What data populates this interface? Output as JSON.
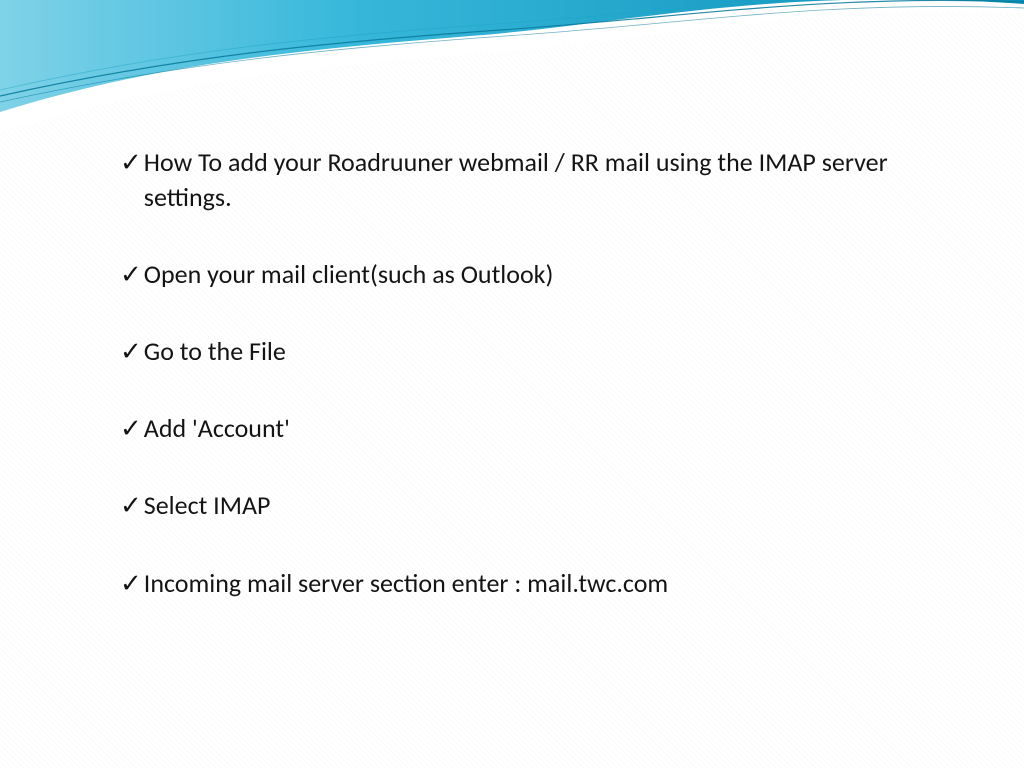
{
  "theme": {
    "swoosh_gradient_start": "#7fd2e8",
    "swoosh_gradient_mid": "#36b7da",
    "swoosh_gradient_end": "#0b8fb8",
    "accent_line": "#0b7c9c",
    "text_color": "#141414",
    "check_glyph": "✓"
  },
  "bullets": [
    "How To add your Roadruuner webmail / RR mail using the IMAP server settings.",
    "Open your mail client(such as Outlook)",
    "Go to the File",
    "Add 'Account'",
    "Select IMAP",
    "Incoming mail server section enter : mail.twc.com"
  ]
}
